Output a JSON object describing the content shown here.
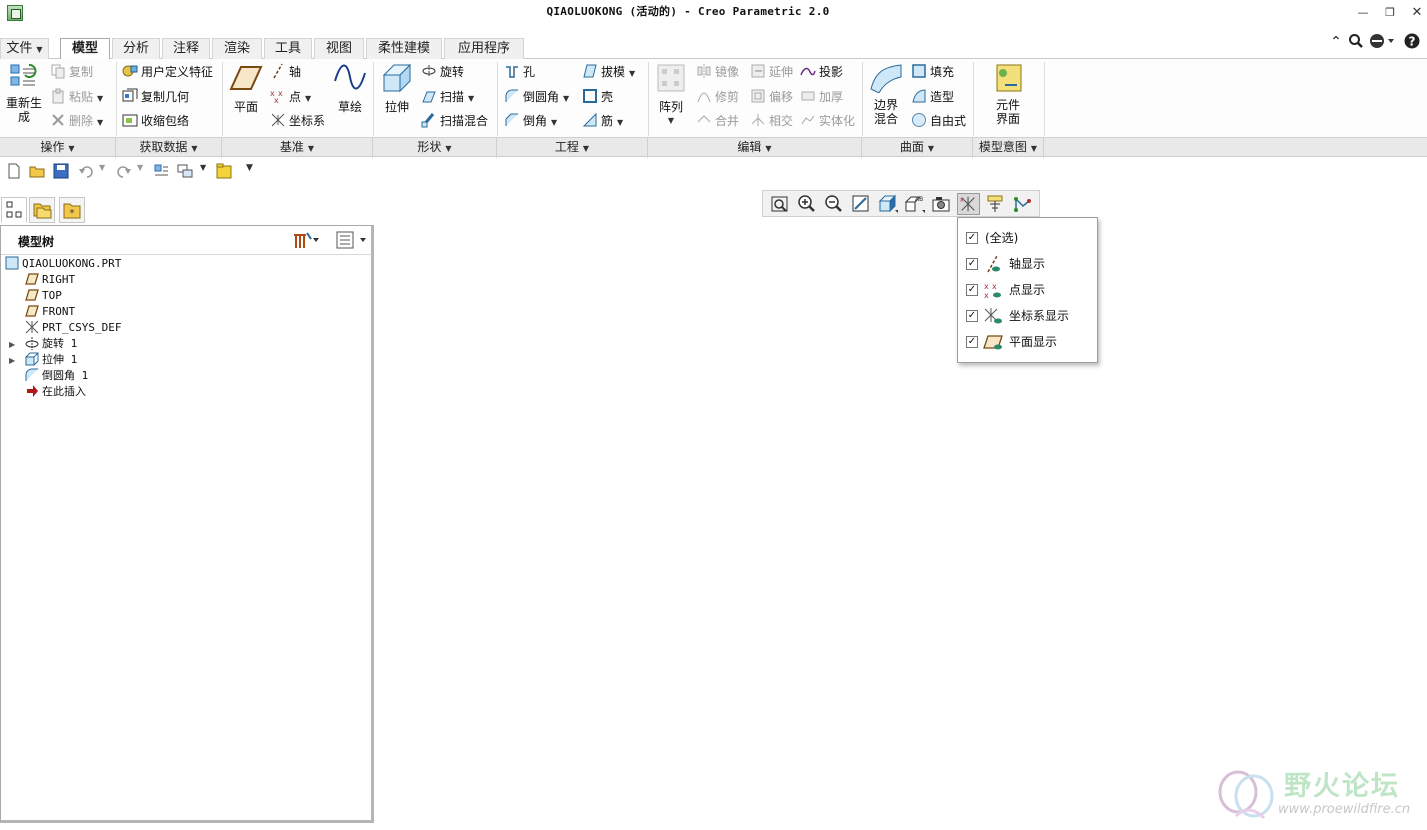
{
  "window": {
    "title": "QIAOLUOKONG (活动的) - Creo Parametric 2.0",
    "controls": [
      "minimize",
      "restore",
      "close"
    ]
  },
  "tabs": [
    {
      "label": "文件",
      "id": "file",
      "has_dropdown": true
    },
    {
      "label": "模型",
      "id": "model",
      "active": true
    },
    {
      "label": "分析",
      "id": "analysis"
    },
    {
      "label": "注释",
      "id": "annotate"
    },
    {
      "label": "渲染",
      "id": "render"
    },
    {
      "label": "工具",
      "id": "tools"
    },
    {
      "label": "视图",
      "id": "view"
    },
    {
      "label": "柔性建模",
      "id": "flexible"
    },
    {
      "label": "应用程序",
      "id": "apps"
    }
  ],
  "ribbon": {
    "operations": {
      "regenerate": "重新生\n成",
      "copy": "复制",
      "paste": "粘贴",
      "delete": "删除",
      "group_label": "操作"
    },
    "get_data": {
      "udf": "用户定义特征",
      "copy_geom": "复制几何",
      "shrinkwrap": "收缩包络",
      "group_label": "获取数据"
    },
    "datum": {
      "plane": "平面",
      "axis": "轴",
      "point": "点",
      "csys": "坐标系",
      "sketch": "草绘",
      "group_label": "基准"
    },
    "shapes": {
      "extrude": "拉伸",
      "revolve": "旋转",
      "sweep": "扫描",
      "swept_blend": "扫描混合",
      "group_label": "形状"
    },
    "engineering": {
      "hole": "孔",
      "round": "倒圆角",
      "chamfer": "倒角",
      "draft": "拔模",
      "shell": "壳",
      "rib": "筋",
      "group_label": "工程"
    },
    "editing": {
      "pattern": "阵列",
      "mirror": "镜像",
      "extend": "延伸",
      "project": "投影",
      "trim": "修剪",
      "offset": "偏移",
      "thicken": "加厚",
      "merge": "合并",
      "intersect": "相交",
      "solidify": "实体化",
      "group_label": "编辑"
    },
    "surfaces": {
      "boundary_blend": "边界\n混合",
      "fill": "填充",
      "style": "造型",
      "freestyle": "自由式",
      "group_label": "曲面"
    },
    "model_intent": {
      "component_interface": "元件\n界面",
      "group_label": "模型意图"
    }
  },
  "model_tree": {
    "title": "模型树",
    "items": [
      {
        "label": "QIAOLUOKONG.PRT",
        "icon": "part-icon",
        "level": 0
      },
      {
        "label": "RIGHT",
        "icon": "datum-plane-icon",
        "level": 1
      },
      {
        "label": "TOP",
        "icon": "datum-plane-icon",
        "level": 1
      },
      {
        "label": "FRONT",
        "icon": "datum-plane-icon",
        "level": 1
      },
      {
        "label": "PRT_CSYS_DEF",
        "icon": "csys-icon",
        "level": 1
      },
      {
        "label": "旋转 1",
        "icon": "revolve-icon",
        "level": 1,
        "expandable": true
      },
      {
        "label": "拉伸 1",
        "icon": "extrude-icon",
        "level": 1,
        "expandable": true
      },
      {
        "label": "倒圆角 1",
        "icon": "round-icon",
        "level": 1
      },
      {
        "label": "在此插入",
        "icon": "insert-here-icon",
        "level": 1
      }
    ]
  },
  "datum_display_menu": {
    "items": [
      {
        "label": "(全选)",
        "checked": true
      },
      {
        "label": "轴显示",
        "checked": true,
        "icon": "axis-display-icon"
      },
      {
        "label": "点显示",
        "checked": true,
        "icon": "point-display-icon"
      },
      {
        "label": "坐标系显示",
        "checked": true,
        "icon": "csys-display-icon"
      },
      {
        "label": "平面显示",
        "checked": true,
        "icon": "plane-display-icon"
      }
    ]
  },
  "watermark": {
    "cn": "野火论坛",
    "url": "www.proewildfire.cn"
  },
  "colors": {
    "accent": "#2b7bd6",
    "check": "#222222",
    "watermark_green": "#bfe5c7"
  }
}
